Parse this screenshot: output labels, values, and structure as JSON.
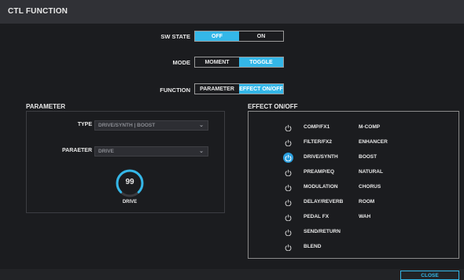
{
  "title": "CTL FUNCTION",
  "sw_state": {
    "label": "SW STATE",
    "options": [
      "OFF",
      "ON"
    ],
    "selected": "OFF"
  },
  "mode": {
    "label": "MODE",
    "options": [
      "MOMENT",
      "TOGGLE"
    ],
    "selected": "TOGGLE"
  },
  "function": {
    "label": "FUNCTION",
    "options": [
      "PARAMETER",
      "EFFECT ON/OFF"
    ],
    "selected": "EFFECT ON/OFF"
  },
  "parameter": {
    "section_title": "PARAMETER",
    "type_label": "TYPE",
    "type_value": "DRIVE/SYNTH | BOOST",
    "param_label": "PARAETER",
    "param_value": "DRIVE",
    "knob_value": "99",
    "knob_label": "DRIVE"
  },
  "effect_onoff": {
    "section_title": "EFFECT ON/OFF",
    "rows": [
      {
        "name": "COMP/FX1",
        "sub": "M-COMP",
        "on": false
      },
      {
        "name": "FILTER/FX2",
        "sub": "ENHANCER",
        "on": false
      },
      {
        "name": "DRIVE/SYNTH",
        "sub": "BOOST",
        "on": true
      },
      {
        "name": "PREAMP/EQ",
        "sub": "NATURAL",
        "on": false
      },
      {
        "name": "MODULATION",
        "sub": "CHORUS",
        "on": false
      },
      {
        "name": "DELAY/REVERB",
        "sub": "ROOM",
        "on": false
      },
      {
        "name": "PEDAL FX",
        "sub": "WAH",
        "on": false
      },
      {
        "name": "SEND/RETURN",
        "sub": "",
        "on": false
      },
      {
        "name": "BLEND",
        "sub": "",
        "on": false
      }
    ]
  },
  "close_label": "CLOSE",
  "colors": {
    "accent": "#34b7e8",
    "power_on": "#2b9fde"
  }
}
